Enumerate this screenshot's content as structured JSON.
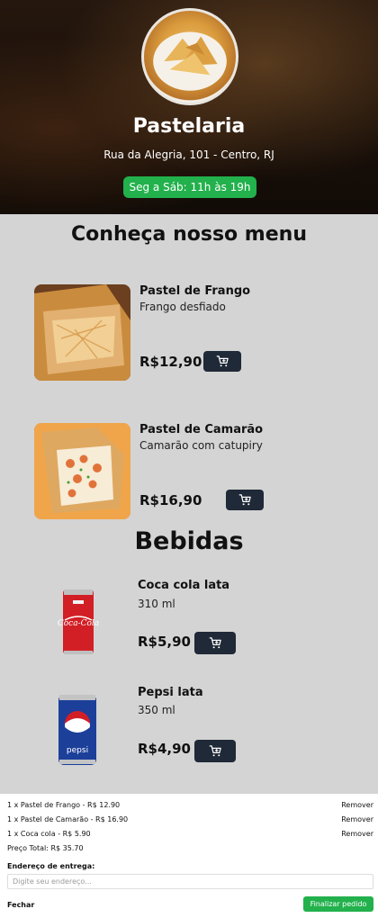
{
  "store": {
    "name": "Pastelaria",
    "address": "Rua da Alegria, 101 - Centro, RJ",
    "hours": "Seg a Sáb: 11h às 19h"
  },
  "menu": {
    "title": "Conheça nosso menu",
    "items": [
      {
        "name": "Pastel de Frango",
        "desc": "Frango desfiado",
        "price": "R$12,90"
      },
      {
        "name": "Pastel de Camarão",
        "desc": "Camarão com catupiry",
        "price": "R$16,90"
      }
    ]
  },
  "drinks": {
    "title": "Bebidas",
    "items": [
      {
        "name": "Coca cola lata",
        "desc": "310 ml",
        "price": "R$5,90"
      },
      {
        "name": "Pepsi lata",
        "desc": "350 ml",
        "price": "R$4,90"
      }
    ]
  },
  "cart": {
    "lines": [
      {
        "text": "1 x Pastel de Frango - R$ 12.90",
        "remove": "Remover"
      },
      {
        "text": "1 x Pastel de Camarão - R$ 16.90",
        "remove": "Remover"
      },
      {
        "text": "1 x Coca cola - R$ 5.90",
        "remove": "Remover"
      }
    ],
    "total": "Preço Total: R$ 35.70",
    "address_label": "Endereço de entrega:",
    "address_placeholder": "Digite seu endereço...",
    "address_value": "",
    "close_label": "Fechar",
    "finish_label": "Finalizar pedido"
  },
  "colors": {
    "accent_green": "#22b14c",
    "button_dark": "#1f2937",
    "page_bg": "#d4d4d4"
  },
  "icons": {
    "cart": "cart-plus-icon"
  }
}
